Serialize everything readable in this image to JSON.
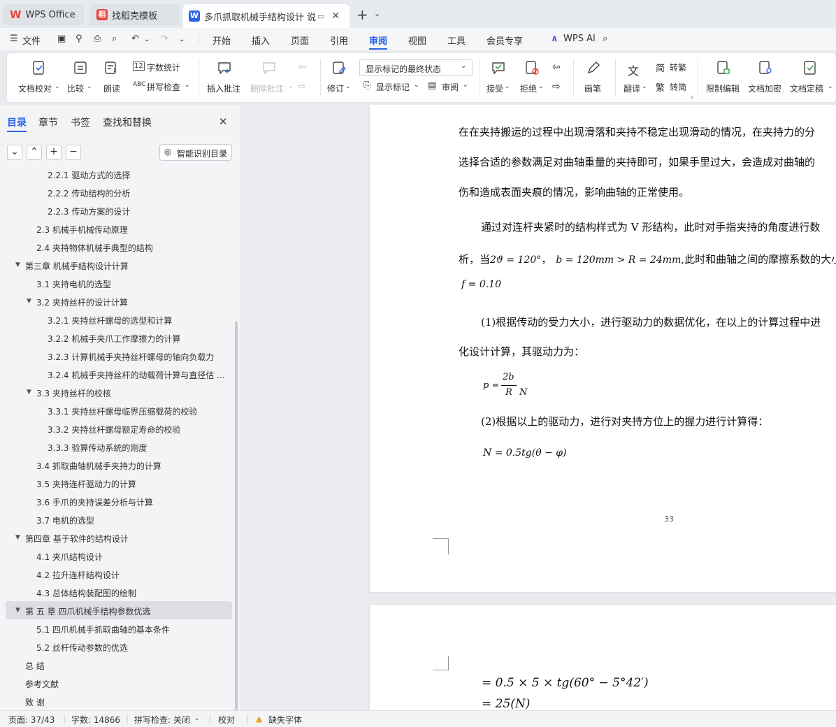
{
  "tabs": {
    "wps_office": "WPS Office",
    "templates": "找稻壳模板",
    "document": "多爪抓取机械手结构设计 说明"
  },
  "menu": {
    "file": "文件",
    "items": [
      "开始",
      "插入",
      "页面",
      "引用",
      "审阅",
      "视图",
      "工具",
      "会员专享"
    ],
    "active": "审阅",
    "wps_ai": "WPS AI"
  },
  "ribbon": {
    "doc_check": "文档校对",
    "compare": "比较",
    "read_aloud": "朗读",
    "word_count": "字数统计",
    "spell_check": "拼写检查",
    "insert_comment": "插入批注",
    "delete_comment": "删除批注",
    "revise": "修订",
    "markup_state": "显示标记的最终状态",
    "show_markup": "显示标记",
    "review_pane": "审阅",
    "accept": "接受",
    "reject": "拒绝",
    "pen": "画笔",
    "translate": "翻译",
    "to_traditional": "转繁",
    "to_simplified": "转简",
    "restrict_edit": "限制编辑",
    "encrypt": "文档加密",
    "finalize": "文档定稿"
  },
  "sidebar": {
    "tabs": [
      "目录",
      "章节",
      "书签",
      "查找和替换"
    ],
    "smart_toc": "智能识别目录",
    "toc": [
      {
        "text": "2.2.1 驱动方式的选择",
        "level": 3
      },
      {
        "text": "2.2.2 传动结构的分析",
        "level": 3
      },
      {
        "text": "2.2.3 传动方案的设计",
        "level": 3
      },
      {
        "text": "2.3 机械手机械传动原理",
        "level": 2
      },
      {
        "text": "2.4 夹持物体机械手典型的结构",
        "level": 2
      },
      {
        "text": "第三章  机械手结构设计计算",
        "level": 1,
        "expanded": true
      },
      {
        "text": "3.1 夹持电机的选型",
        "level": 2
      },
      {
        "text": "3.2 夹持丝杆的设计计算",
        "level": 2,
        "expanded": true
      },
      {
        "text": "3.2.1 夹持丝杆螺母的选型和计算",
        "level": 3
      },
      {
        "text": "3.2.2 机械手夹爪工作摩擦力的计算",
        "level": 3
      },
      {
        "text": "3.2.3 计算机械手夹持丝杆螺母的轴向负载力",
        "level": 3
      },
      {
        "text": "3.2.4 机械手夹持丝杆的动载荷计算与直径估 ...",
        "level": 3
      },
      {
        "text": "3.3  夹持丝杆的校核",
        "level": 2,
        "expanded": true
      },
      {
        "text": "3.3.1 夹持丝杆螺母临界压缩载荷的校验",
        "level": 3
      },
      {
        "text": "3.3.2 夹持丝杆螺母额定寿命的校验",
        "level": 3
      },
      {
        "text": "3.3.3 验算传动系统的刚度",
        "level": 3
      },
      {
        "text": "3.4 抓取曲轴机械手夹持力的计算",
        "level": 2
      },
      {
        "text": "3.5 夹持连杆驱动力的计算",
        "level": 2
      },
      {
        "text": "3.6 手爪的夹持误差分析与计算",
        "level": 2
      },
      {
        "text": "3.7 电机的选型",
        "level": 2
      },
      {
        "text": "第四章  基于软件的结构设计",
        "level": 1,
        "expanded": true
      },
      {
        "text": "4.1  夹爪结构设计",
        "level": 2
      },
      {
        "text": "4.2  拉升连杆结构设计",
        "level": 2
      },
      {
        "text": "4.3 总体结构装配图的绘制",
        "level": 2
      },
      {
        "text": "第 五 章  四爪机械手结构参数优选",
        "level": 1,
        "expanded": true,
        "selected": true
      },
      {
        "text": "5.1 四爪机械手抓取曲轴的基本条件",
        "level": 2
      },
      {
        "text": "5.2 丝杆传动参数的优选",
        "level": 2
      },
      {
        "text": "总  结",
        "level": 1
      },
      {
        "text": "参考文献",
        "level": 1
      },
      {
        "text": "致  谢",
        "level": 1
      }
    ]
  },
  "document": {
    "p1": "在在夹持搬运的过程中出现滑落和夹持不稳定出现滑动的情况，在夹持力的分",
    "p2": "选择合适的参数满足对曲轴重量的夹持即可，如果手里过大，会造成对曲轴的",
    "p3": "伤和造成表面夹痕的情况，影响曲轴的正常使用。",
    "p4": "通过对连杆夹紧时的结构样式为 V 形结构，此时对手指夹持的角度进行数",
    "p5_a": "析，当",
    "p5_math1": "2ϑ = 120°",
    "p5_sep": "，",
    "p5_math2": "b = 120mm > R = 24mm",
    "p5_b": ",此时和曲轴之间的摩擦系数的大小",
    "p6_math": "f = 0.10",
    "p7": "(1)根据传动的受力大小，进行驱动力的数据优化，在以上的计算过程中进",
    "p8": "化设计计算，其驱动力为：",
    "eq1_lhs": "p =",
    "eq1_num": "2b",
    "eq1_den": "R",
    "eq1_unit": "N",
    "p9": "(2)根据以上的驱动力，进行对夹持方位上的握力进行计算得：",
    "eq2": "N = 0.5tg(θ − φ)",
    "page_number": "33",
    "eq3": "= 0.5 × 5 × tg(60° − 5°42′)",
    "eq4": "= 25(N)"
  },
  "status": {
    "page": "页面: 37/43",
    "words": "字数: 14866",
    "spell": "拼写检查: 关闭",
    "proof": "校对",
    "missing_font": "缺失字体"
  },
  "colors": {
    "accent": "#2b63e5",
    "wps_red": "#e8413b",
    "warning": "#f0a020"
  }
}
